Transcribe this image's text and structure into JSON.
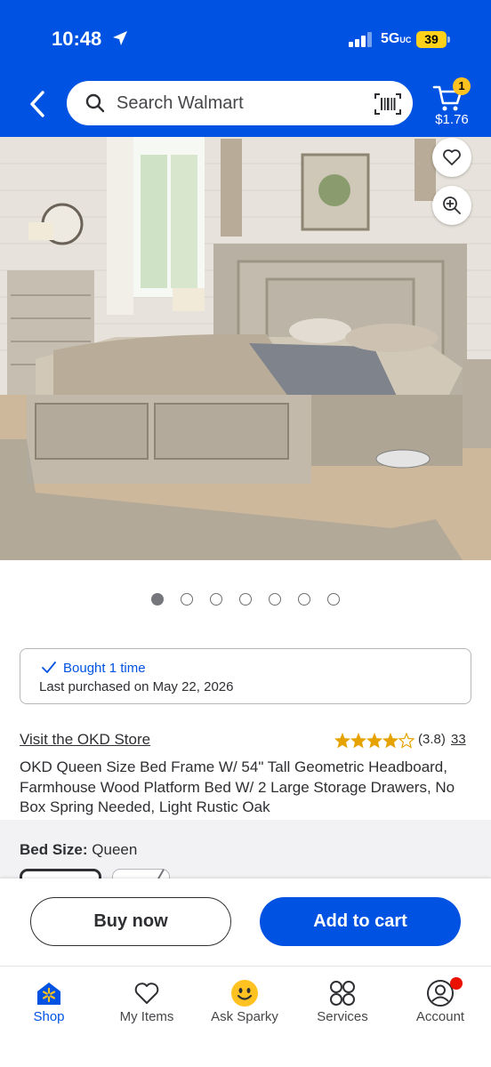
{
  "status_bar": {
    "time": "10:48",
    "network": "5G",
    "network_suffix": "UC",
    "battery": "39"
  },
  "header": {
    "search_placeholder": "Search Walmart",
    "cart_count": "1",
    "cart_total": "$1.76",
    "brand_color": "#0053e2"
  },
  "gallery": {
    "image_count": 7,
    "active_index": 0
  },
  "purchase_history": {
    "line1": "Bought 1 time",
    "line2": "Last purchased on May 22, 2026"
  },
  "product": {
    "store_link": "Visit the OKD Store",
    "rating_value": "(3.8)",
    "rating": 3.8,
    "review_count": "33",
    "title": "OKD Queen Size Bed Frame W/ 54\" Tall Geometric Headboard, Farmhouse Wood Platform Bed W/ 2 Large Storage Drawers, No Box Spring Needed, Light Rustic Oak"
  },
  "variant": {
    "label": "Bed Size:",
    "value": "Queen"
  },
  "actions": {
    "buy_now": "Buy now",
    "add_to_cart": "Add to cart"
  },
  "tabs": [
    {
      "label": "Shop",
      "icon": "walmart-spark-home-icon"
    },
    {
      "label": "My Items",
      "icon": "heart-icon"
    },
    {
      "label": "Ask Sparky",
      "icon": "sparky-face-icon"
    },
    {
      "label": "Services",
      "icon": "services-grid-icon"
    },
    {
      "label": "Account",
      "icon": "account-icon"
    }
  ]
}
